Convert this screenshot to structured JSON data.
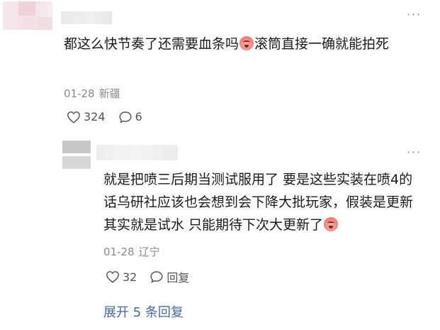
{
  "main_comment": {
    "text_parts": [
      "都这么快节奏了还需要血条吗",
      "滚筒直接一确就能拍死"
    ],
    "date": "01-28",
    "location": "新疆",
    "likes": "324",
    "replies_count": "6"
  },
  "reply_comment": {
    "text": "就是把喷三后期当测试服用了 要是这些实装在喷4的话乌研社应该也会想到会下降大批玩家，假装是更新其实就是试水 只能期待下次大更新了",
    "date": "01-28",
    "location": "辽宁",
    "likes": "32",
    "reply_label": "回复"
  },
  "expand_label": "展开 5 条回复",
  "icons": {
    "more": "more-dots-icon",
    "like": "heart-icon",
    "comment": "comment-bubble-icon",
    "emoji": "crying-face-emoji"
  },
  "colors": {
    "link": "#4a6a9e",
    "meta": "#8a8a8a",
    "text": "#1a1a1a"
  }
}
